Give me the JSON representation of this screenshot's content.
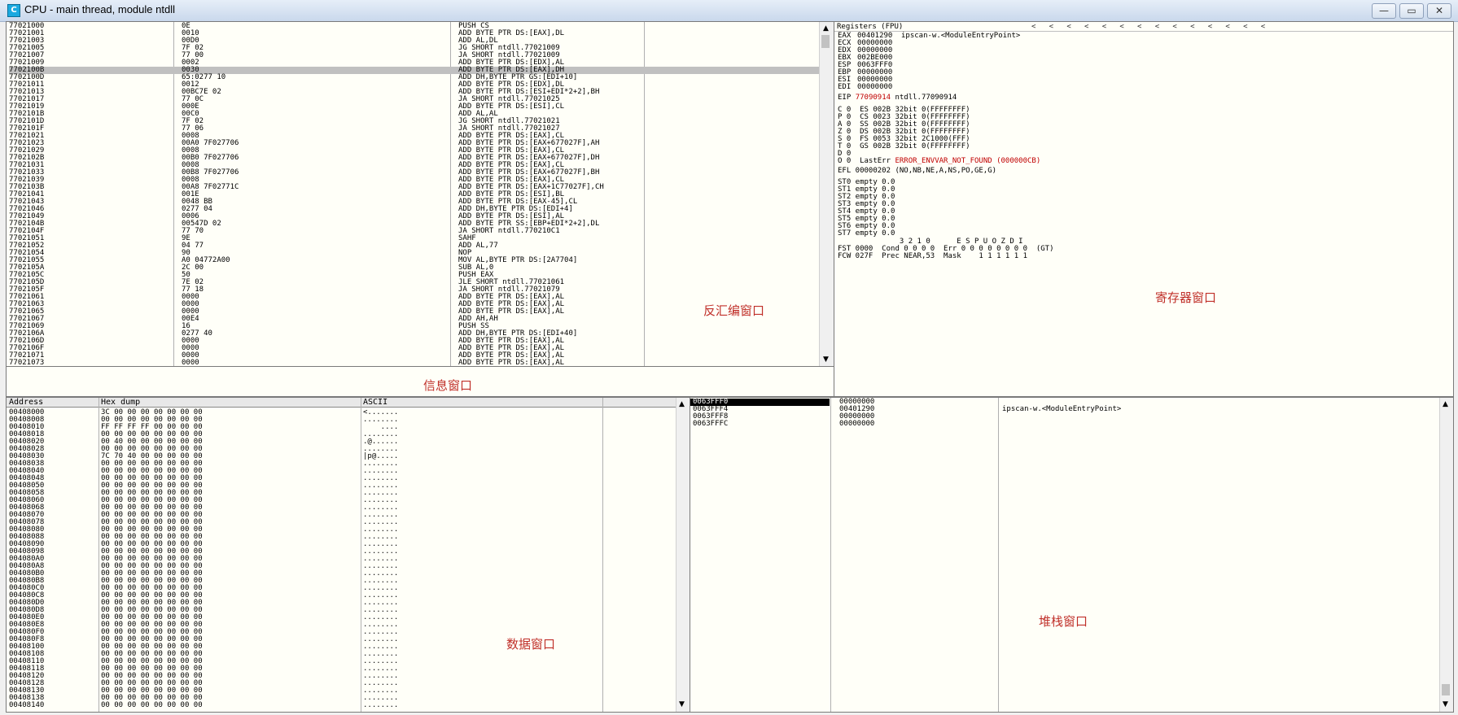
{
  "window": {
    "title": "CPU - main thread, module ntdll",
    "icon_label": "C",
    "buttons": {
      "minimize": "—",
      "maximize": "▭",
      "close": "✕"
    }
  },
  "disasm": {
    "label": "反汇编窗口",
    "rows": [
      [
        "77021000",
        "0E",
        "PUSH CS"
      ],
      [
        "77021001",
        "0010",
        "ADD BYTE PTR DS:[EAX],DL"
      ],
      [
        "77021003",
        "00D0",
        "ADD AL,DL"
      ],
      [
        "77021005",
        "7F 02",
        "JG SHORT ntdll.77021009"
      ],
      [
        "77021007",
        "77 00",
        "JA SHORT ntdll.77021009"
      ],
      [
        "77021009",
        "0002",
        "ADD BYTE PTR DS:[EDX],AL"
      ],
      [
        "7702100B",
        "0030",
        "ADD BYTE PTR DS:[EAX],DH"
      ],
      [
        "7702100D",
        "65:0277 10",
        "ADD DH,BYTE PTR GS:[EDI+10]"
      ],
      [
        "77021011",
        "0012",
        "ADD BYTE PTR DS:[EDX],DL"
      ],
      [
        "77021013",
        "00BC7E 02",
        "ADD BYTE PTR DS:[ESI+EDI*2+2],BH"
      ],
      [
        "77021017",
        "77 0C",
        "JA SHORT ntdll.77021025"
      ],
      [
        "77021019",
        "000E",
        "ADD BYTE PTR DS:[ESI],CL"
      ],
      [
        "7702101B",
        "00C0",
        "ADD AL,AL"
      ],
      [
        "7702101D",
        "7F 02",
        "JG SHORT ntdll.77021021"
      ],
      [
        "7702101F",
        "77 06",
        "JA SHORT ntdll.77021027"
      ],
      [
        "77021021",
        "0008",
        "ADD BYTE PTR DS:[EAX],CL"
      ],
      [
        "77021023",
        "00A0 7F027706",
        "ADD BYTE PTR DS:[EAX+677027F],AH"
      ],
      [
        "77021029",
        "0008",
        "ADD BYTE PTR DS:[EAX],CL"
      ],
      [
        "7702102B",
        "00B0 7F027706",
        "ADD BYTE PTR DS:[EAX+677027F],DH"
      ],
      [
        "77021031",
        "0008",
        "ADD BYTE PTR DS:[EAX],CL"
      ],
      [
        "77021033",
        "00B8 7F027706",
        "ADD BYTE PTR DS:[EAX+677027F],BH"
      ],
      [
        "77021039",
        "0008",
        "ADD BYTE PTR DS:[EAX],CL"
      ],
      [
        "7702103B",
        "00A8 7F02771C",
        "ADD BYTE PTR DS:[EAX+1C77027F],CH"
      ],
      [
        "77021041",
        "001E",
        "ADD BYTE PTR DS:[ESI],BL"
      ],
      [
        "77021043",
        "0048 BB",
        "ADD BYTE PTR DS:[EAX-45],CL"
      ],
      [
        "77021046",
        "0277 04",
        "ADD DH,BYTE PTR DS:[EDI+4]"
      ],
      [
        "77021049",
        "0006",
        "ADD BYTE PTR DS:[ESI],AL"
      ],
      [
        "7702104B",
        "00547D 02",
        "ADD BYTE PTR SS:[EBP+EDI*2+2],DL"
      ],
      [
        "7702104F",
        "77 70",
        "JA SHORT ntdll.770210C1"
      ],
      [
        "77021051",
        "9E",
        "SAHF"
      ],
      [
        "77021052",
        "04 77",
        "ADD AL,77"
      ],
      [
        "77021054",
        "90",
        "NOP"
      ],
      [
        "77021055",
        "A0 04772A00",
        "MOV AL,BYTE PTR DS:[2A7704]"
      ],
      [
        "7702105A",
        "2C 00",
        "SUB AL,0"
      ],
      [
        "7702105C",
        "50",
        "PUSH EAX"
      ],
      [
        "7702105D",
        "7E 02",
        "JLE SHORT ntdll.77021061"
      ],
      [
        "7702105F",
        "77 18",
        "JA SHORT ntdll.77021079"
      ],
      [
        "77021061",
        "0000",
        "ADD BYTE PTR DS:[EAX],AL"
      ],
      [
        "77021063",
        "0000",
        "ADD BYTE PTR DS:[EAX],AL"
      ],
      [
        "77021065",
        "0000",
        "ADD BYTE PTR DS:[EAX],AL"
      ],
      [
        "77021067",
        "00E4",
        "ADD AH,AH"
      ],
      [
        "77021069",
        "16",
        "PUSH SS"
      ],
      [
        "7702106A",
        "0277 40",
        "ADD DH,BYTE PTR DS:[EDI+40]"
      ],
      [
        "7702106D",
        "0000",
        "ADD BYTE PTR DS:[EAX],AL"
      ],
      [
        "7702106F",
        "0000",
        "ADD BYTE PTR DS:[EAX],AL"
      ],
      [
        "77021071",
        "0000",
        "ADD BYTE PTR DS:[EAX],AL"
      ],
      [
        "77021073",
        "0000",
        "ADD BYTE PTR DS:[EAX],AL"
      ]
    ]
  },
  "info": {
    "label": "信息窗口"
  },
  "registers": {
    "header": "Registers (FPU)",
    "label": "寄存器窗口",
    "arrows": "<   <   <   <   <   <   <   <   <   <   <   <   <   <",
    "gp": [
      [
        "EAX",
        "00401290",
        "ipscan-w.<ModuleEntryPoint>"
      ],
      [
        "ECX",
        "00000000",
        ""
      ],
      [
        "EDX",
        "00000000",
        ""
      ],
      [
        "EBX",
        "002BE000",
        ""
      ],
      [
        "ESP",
        "0063FFF0",
        ""
      ],
      [
        "EBP",
        "00000000",
        ""
      ],
      [
        "ESI",
        "00000000",
        ""
      ],
      [
        "EDI",
        "00000000",
        ""
      ]
    ],
    "eip": {
      "name": "EIP",
      "value": "77090914",
      "comment": "ntdll.77090914"
    },
    "flags": [
      "C 0  ES 002B 32bit 0(FFFFFFFF)",
      "P 0  CS 0023 32bit 0(FFFFFFFF)",
      "A 0  SS 002B 32bit 0(FFFFFFFF)",
      "Z 0  DS 002B 32bit 0(FFFFFFFF)",
      "S 0  FS 0053 32bit 2C1000(FFF)",
      "T 0  GS 002B 32bit 0(FFFFFFFF)",
      "D 0"
    ],
    "lasterr_prefix": "O 0  LastErr ",
    "lasterr": "ERROR_ENVVAR_NOT_FOUND (000000CB)",
    "efl": "EFL 00000202 (NO,NB,NE,A,NS,PO,GE,G)",
    "fpu": [
      "ST0 empty 0.0",
      "ST1 empty 0.0",
      "ST2 empty 0.0",
      "ST3 empty 0.0",
      "ST4 empty 0.0",
      "ST5 empty 0.0",
      "ST6 empty 0.0",
      "ST7 empty 0.0"
    ],
    "fpu_bits": "              3 2 1 0      E S P U O Z D I",
    "fst": "FST 0000  Cond 0 0 0 0  Err 0 0 0 0 0 0 0 0  (GT)",
    "fcw": "FCW 027F  Prec NEAR,53  Mask    1 1 1 1 1 1"
  },
  "dump": {
    "label": "数据窗口",
    "headers": {
      "address": "Address",
      "hex": "Hex dump",
      "ascii": "ASCII"
    },
    "rows": [
      [
        "00408000",
        "3C 00 00 00 00 00 00 00",
        "<......."
      ],
      [
        "00408008",
        "00 00 00 00 00 00 00 00",
        "........"
      ],
      [
        "00408010",
        "FF FF FF FF 00 00 00 00",
        "    ...."
      ],
      [
        "00408018",
        "00 00 00 00 00 00 00 00",
        "........"
      ],
      [
        "00408020",
        "00 40 00 00 00 00 00 00",
        ".@......"
      ],
      [
        "00408028",
        "00 00 00 00 00 00 00 00",
        "........"
      ],
      [
        "00408030",
        "7C 70 40 00 00 00 00 00",
        "|p@....."
      ],
      [
        "00408038",
        "00 00 00 00 00 00 00 00",
        "........"
      ],
      [
        "00408040",
        "00 00 00 00 00 00 00 00",
        "........"
      ],
      [
        "00408048",
        "00 00 00 00 00 00 00 00",
        "........"
      ],
      [
        "00408050",
        "00 00 00 00 00 00 00 00",
        "........"
      ],
      [
        "00408058",
        "00 00 00 00 00 00 00 00",
        "........"
      ],
      [
        "00408060",
        "00 00 00 00 00 00 00 00",
        "........"
      ],
      [
        "00408068",
        "00 00 00 00 00 00 00 00",
        "........"
      ],
      [
        "00408070",
        "00 00 00 00 00 00 00 00",
        "........"
      ],
      [
        "00408078",
        "00 00 00 00 00 00 00 00",
        "........"
      ],
      [
        "00408080",
        "00 00 00 00 00 00 00 00",
        "........"
      ],
      [
        "00408088",
        "00 00 00 00 00 00 00 00",
        "........"
      ],
      [
        "00408090",
        "00 00 00 00 00 00 00 00",
        "........"
      ],
      [
        "00408098",
        "00 00 00 00 00 00 00 00",
        "........"
      ],
      [
        "004080A0",
        "00 00 00 00 00 00 00 00",
        "........"
      ],
      [
        "004080A8",
        "00 00 00 00 00 00 00 00",
        "........"
      ],
      [
        "004080B0",
        "00 00 00 00 00 00 00 00",
        "........"
      ],
      [
        "004080B8",
        "00 00 00 00 00 00 00 00",
        "........"
      ],
      [
        "004080C0",
        "00 00 00 00 00 00 00 00",
        "........"
      ],
      [
        "004080C8",
        "00 00 00 00 00 00 00 00",
        "........"
      ],
      [
        "004080D0",
        "00 00 00 00 00 00 00 00",
        "........"
      ],
      [
        "004080D8",
        "00 00 00 00 00 00 00 00",
        "........"
      ],
      [
        "004080E0",
        "00 00 00 00 00 00 00 00",
        "........"
      ],
      [
        "004080E8",
        "00 00 00 00 00 00 00 00",
        "........"
      ],
      [
        "004080F0",
        "00 00 00 00 00 00 00 00",
        "........"
      ],
      [
        "004080F8",
        "00 00 00 00 00 00 00 00",
        "........"
      ],
      [
        "00408100",
        "00 00 00 00 00 00 00 00",
        "........"
      ],
      [
        "00408108",
        "00 00 00 00 00 00 00 00",
        "........"
      ],
      [
        "00408110",
        "00 00 00 00 00 00 00 00",
        "........"
      ],
      [
        "00408118",
        "00 00 00 00 00 00 00 00",
        "........"
      ],
      [
        "00408120",
        "00 00 00 00 00 00 00 00",
        "........"
      ],
      [
        "00408128",
        "00 00 00 00 00 00 00 00",
        "........"
      ],
      [
        "00408130",
        "00 00 00 00 00 00 00 00",
        "........"
      ],
      [
        "00408138",
        "00 00 00 00 00 00 00 00",
        "........"
      ],
      [
        "00408140",
        "00 00 00 00 00 00 00 00",
        "........"
      ]
    ]
  },
  "stack": {
    "label": "堆栈窗口",
    "rows": [
      [
        "0063FFF0",
        "00000000",
        ""
      ],
      [
        "0063FFF4",
        "00401290",
        "ipscan-w.<ModuleEntryPoint>"
      ],
      [
        "0063FFF8",
        "00000000",
        ""
      ],
      [
        "0063FFFC",
        "00000000",
        ""
      ]
    ]
  }
}
